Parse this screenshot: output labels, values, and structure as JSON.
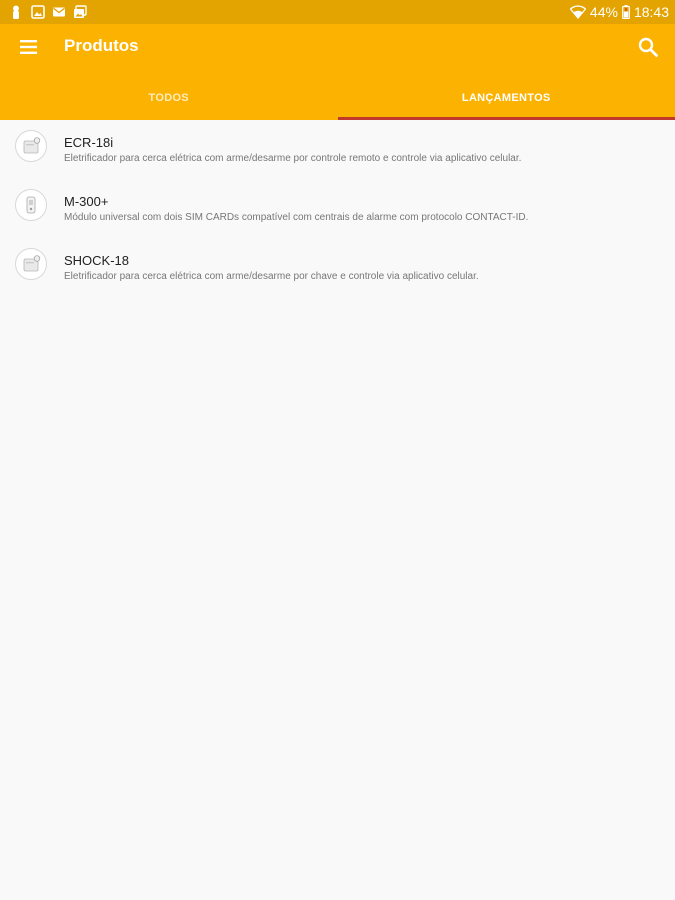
{
  "status_bar": {
    "battery": "44%",
    "time": "18:43",
    "left_icons": [
      "person-pin-icon",
      "image-icon",
      "mail-icon",
      "photos-icon"
    ],
    "right_icons": [
      "wifi-icon",
      "battery-icon"
    ]
  },
  "app_bar": {
    "title": "Produtos",
    "menu_icon": "menu-icon",
    "search_icon": "search-icon",
    "background": "#fbb200",
    "status_color": "#e3a300",
    "indicator_color": "#c0392b"
  },
  "tabs": [
    {
      "label": "TODOS",
      "active": false
    },
    {
      "label": "LANÇAMENTOS",
      "active": true
    }
  ],
  "products": [
    {
      "name": "ECR-18i",
      "description": "Eletrificador para cerca elétrica com arme/desarme por controle remoto e controle via aplicativo celular.",
      "thumbnail": "box-device-icon"
    },
    {
      "name": "M-300+",
      "description": "Módulo universal com dois SIM CARDs compatível com centrais de alarme com protocolo CONTACT-ID.",
      "thumbnail": "module-device-icon"
    },
    {
      "name": "SHOCK-18",
      "description": "Eletrificador para cerca elétrica com arme/desarme por chave e controle via aplicativo celular.",
      "thumbnail": "box-device-icon"
    }
  ]
}
